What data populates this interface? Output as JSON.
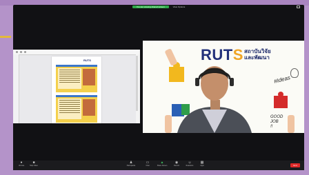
{
  "meeting": {
    "share_banner": "You are viewing shared screen",
    "view_options": "View Options",
    "fullscreen_icon": "expand-icon"
  },
  "share_tile": {
    "doc_logo": "RUTS",
    "participant_name": ""
  },
  "speaker_tile": {
    "logo_main": "RUT",
    "logo_accent": "S",
    "institute_line1": "สถาบันวิจัย",
    "institute_line2": "และพัฒนา",
    "institute_sub": "",
    "ideas_text": "#Ideas",
    "good_job_line1": "GOOD",
    "good_job_line2": "JOB",
    "good_job_line3": "!!",
    "participant_name": ""
  },
  "toolbar": {
    "unmute": {
      "label": "Unmute",
      "icon": "microphone-icon"
    },
    "video": {
      "label": "Stop Video",
      "icon": "video-camera-icon"
    },
    "participants": {
      "label": "Participants",
      "icon": "participants-icon",
      "count": "28"
    },
    "chat": {
      "label": "Chat",
      "icon": "chat-icon"
    },
    "share": {
      "label": "Share Screen",
      "icon": "share-screen-icon"
    },
    "record": {
      "label": "Record",
      "icon": "record-icon"
    },
    "reactions": {
      "label": "Reactions",
      "icon": "reactions-icon"
    },
    "apps": {
      "label": "Apps",
      "icon": "apps-icon"
    },
    "end": "End"
  },
  "colors": {
    "wall": "#b493c9",
    "window_bg": "#111114",
    "share_pill": "#2ea84a",
    "end_button": "#e02828",
    "ruts_blue": "#22307a",
    "ruts_orange": "#f0a526"
  }
}
